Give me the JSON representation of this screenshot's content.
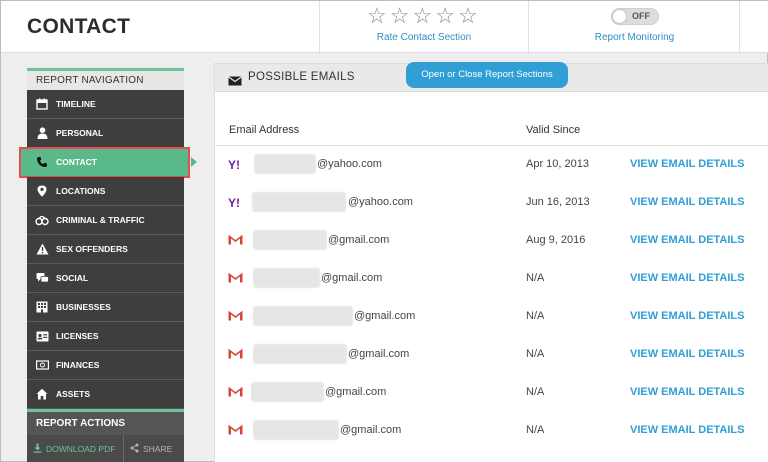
{
  "header": {
    "title": "CONTACT",
    "rate_label": "Rate Contact Section",
    "rating_stars": 5,
    "rating_value": 0,
    "monitor_label": "Report Monitoring",
    "monitor_toggle": "OFF"
  },
  "sidebar": {
    "nav_title": "REPORT NAVIGATION",
    "items": [
      {
        "label": "TIMELINE",
        "icon": "calendar-icon"
      },
      {
        "label": "PERSONAL",
        "icon": "person-icon"
      },
      {
        "label": "CONTACT",
        "icon": "phone-icon",
        "active": true
      },
      {
        "label": "LOCATIONS",
        "icon": "map-pin-icon"
      },
      {
        "label": "CRIMINAL & TRAFFIC",
        "icon": "handcuffs-icon"
      },
      {
        "label": "SEX OFFENDERS",
        "icon": "warning-icon"
      },
      {
        "label": "SOCIAL",
        "icon": "chat-icon"
      },
      {
        "label": "BUSINESSES",
        "icon": "building-icon"
      },
      {
        "label": "LICENSES",
        "icon": "id-card-icon"
      },
      {
        "label": "FINANCES",
        "icon": "money-icon"
      },
      {
        "label": "ASSETS",
        "icon": "house-icon"
      }
    ],
    "actions_title": "REPORT ACTIONS",
    "download_label": "DOWNLOAD PDF",
    "share_label": "SHARE"
  },
  "main": {
    "section_title": "POSSIBLE EMAILS",
    "toggle_sections_label": "Open or Close Report Sections",
    "columns": {
      "email": "Email Address",
      "valid_since": "Valid Since"
    },
    "details_label": "VIEW EMAIL DETAILS",
    "emails": [
      {
        "provider": "yahoo",
        "domain": "@yahoo.com",
        "valid_since": "Apr 10, 2013"
      },
      {
        "provider": "yahoo",
        "domain": "@yahoo.com",
        "valid_since": "Jun 16, 2013"
      },
      {
        "provider": "gmail",
        "domain": "@gmail.com",
        "valid_since": "Aug 9, 2016"
      },
      {
        "provider": "gmail",
        "domain": "@gmail.com",
        "valid_since": "N/A"
      },
      {
        "provider": "gmail",
        "domain": "@gmail.com",
        "valid_since": "N/A"
      },
      {
        "provider": "gmail",
        "domain": "@gmail.com",
        "valid_since": "N/A"
      },
      {
        "provider": "gmail",
        "domain": "@gmail.com",
        "valid_since": "N/A"
      },
      {
        "provider": "gmail",
        "domain": "@gmail.com",
        "valid_since": "N/A"
      }
    ]
  },
  "colors": {
    "accent_green": "#59b98a",
    "link_blue": "#2f9fd6",
    "nav_dark": "#3e3e3e",
    "highlight_red": "#e74c4c",
    "yahoo_purple": "#6b1fa8",
    "gmail_red": "#d44638"
  }
}
